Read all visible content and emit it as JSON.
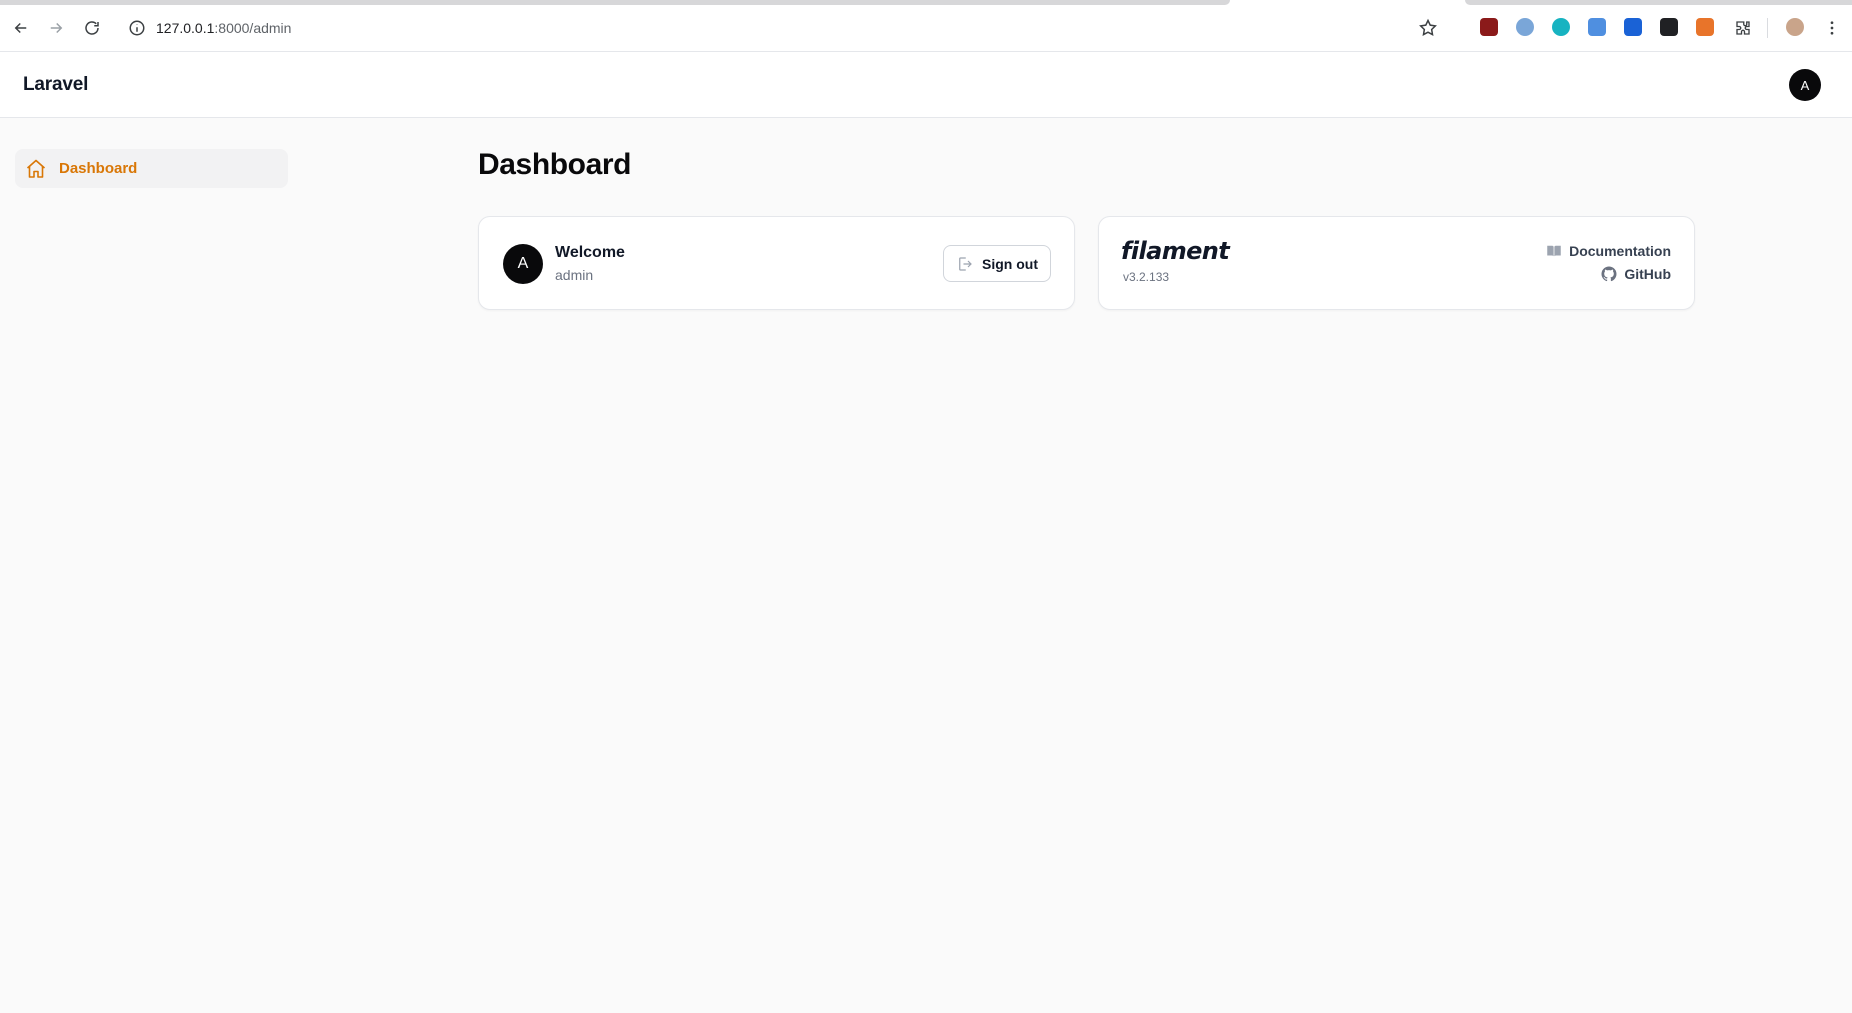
{
  "browser": {
    "url_host": "127.0.0.1",
    "url_rest": ":8000/admin"
  },
  "app": {
    "brand": "Laravel",
    "user_initial": "A"
  },
  "sidebar": {
    "items": [
      {
        "label": "Dashboard",
        "icon": "home-icon",
        "active": true
      }
    ]
  },
  "main": {
    "title": "Dashboard",
    "welcome_card": {
      "avatar_initial": "A",
      "title": "Welcome",
      "subtitle": "admin",
      "signout_label": "Sign out"
    },
    "filament_card": {
      "logo_text": "filament",
      "version": "v3.2.133",
      "documentation_label": "Documentation",
      "github_label": "GitHub"
    }
  },
  "colors": {
    "accent": "#d97706",
    "sidebar_active_bg": "#f2f2f3",
    "page_bg": "#fafafa"
  }
}
